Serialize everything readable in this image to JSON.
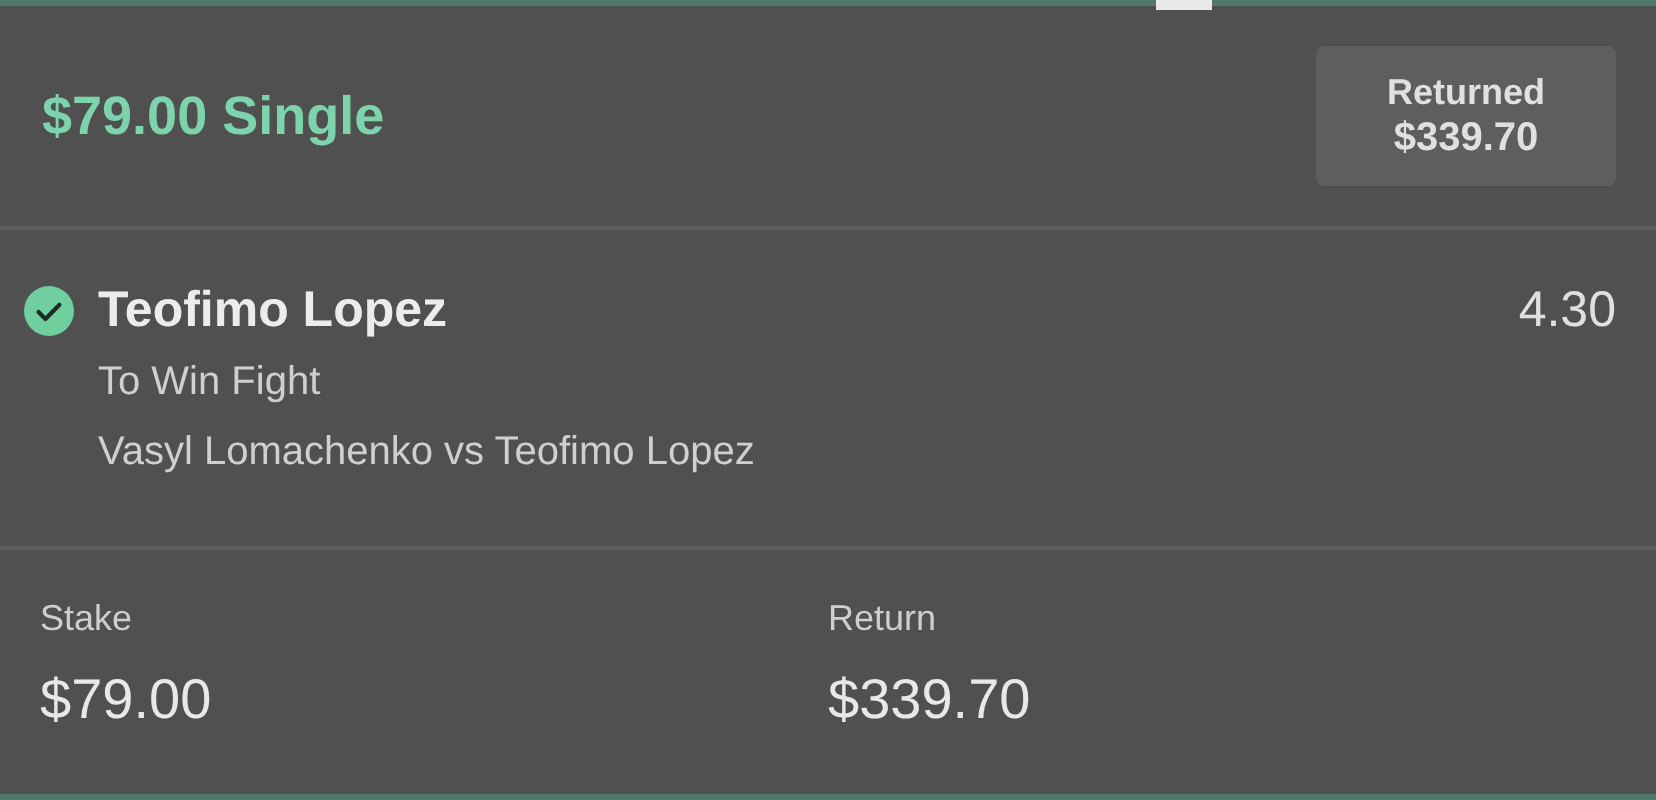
{
  "bet": {
    "title": "$79.00 Single",
    "returned_label": "Returned",
    "returned_amount": "$339.70"
  },
  "selection": {
    "name": "Teofimo Lopez",
    "odds": "4.30",
    "market": "To Win Fight",
    "event": "Vasyl Lomachenko vs Teofimo Lopez",
    "won": true
  },
  "summary": [
    {
      "label": "Stake",
      "value": "$79.00"
    },
    {
      "label": "Return",
      "value": "$339.70"
    }
  ]
}
